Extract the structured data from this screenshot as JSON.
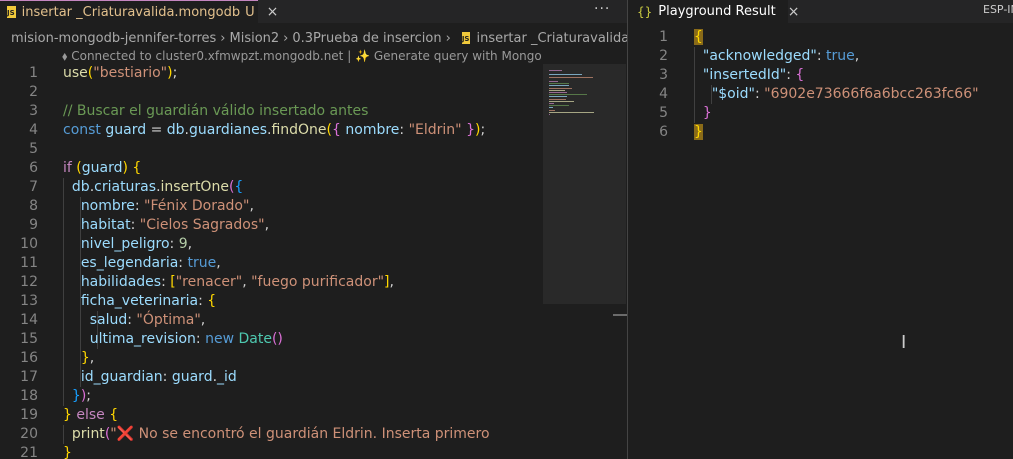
{
  "left_editor": {
    "tab": {
      "icon": "js-file-icon",
      "badge": "JS",
      "title": "insertar _Criaturavalida.mongodb",
      "status": "U",
      "close": "×"
    },
    "more_actions": "···",
    "breadcrumb": {
      "items": [
        "mision-mongodb-jennifer-torres",
        "Mision2",
        "0.3Prueba de insercion"
      ],
      "file_badge": "JS",
      "file": "insertar _Criaturavalida.mongodb"
    },
    "codelens": {
      "connection": "Connected to cluster0.xfmwpzt.mongodb.net",
      "divider": "|",
      "spark": "✨",
      "action": "Generate query with MongoDB Copilot"
    },
    "line_numbers": [
      "1",
      "2",
      "3",
      "4",
      "5",
      "6",
      "7",
      "8",
      "9",
      "10",
      "11",
      "12",
      "13",
      "14",
      "15",
      "16",
      "17",
      "18",
      "19",
      "20",
      "21"
    ]
  },
  "right_editor": {
    "tab": {
      "icon": "json-braces-icon",
      "icon_glyph": "{}",
      "title": "Playground Result",
      "close": "×"
    },
    "esp_label": "ESP-IN",
    "line_numbers": [
      "1",
      "2",
      "3",
      "4",
      "5",
      "6"
    ],
    "result": {
      "open_brace": "{",
      "ack_key": "\"acknowledged\"",
      "ack_value": "true",
      "inserted_key": "\"insertedId\"",
      "oid_key": "\"$oid\"",
      "oid_value": "\"6902e73666f6a6bcc263fc66\"",
      "close_inner": "}",
      "close_brace": "}"
    }
  },
  "theme": {
    "background": "#1e1e1e",
    "tabbar": "#252526",
    "accent": "#c586c0"
  }
}
